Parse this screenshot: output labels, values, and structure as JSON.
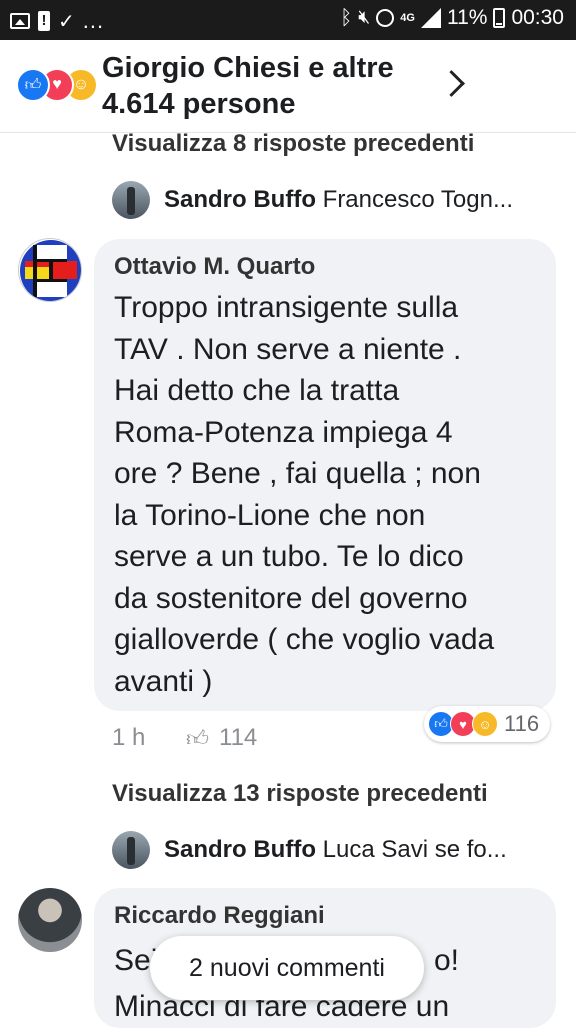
{
  "status_bar": {
    "network": "4G",
    "battery": "11%",
    "time": "00:30",
    "more": "..."
  },
  "header": {
    "title": "Giorgio Chiesi e altre 4.614 persone",
    "reactions": [
      "like",
      "love",
      "haha"
    ]
  },
  "thread1": {
    "view_previous": "Visualizza 8 risposte precedenti",
    "reply": {
      "name": "Sandro Buffo",
      "text": "Francesco Togn..."
    }
  },
  "comment1": {
    "name": "Ottavio M. Quarto",
    "text": "Troppo intransigente sulla\nTAV . Non serve a niente .\nHai detto che la tratta\nRoma-Potenza impiega 4\nore ? Bene , fai quella ; non\nla Torino-Lione che non\nserve a un tubo. Te lo dico\nda sostenitore del governo\ngialloverde ( che voglio vada\navanti )",
    "time": "1 h",
    "likes": "114",
    "reaction_count": "116"
  },
  "thread2": {
    "view_previous": "Visualizza 13 risposte precedenti",
    "reply": {
      "name": "Sandro Buffo",
      "text": "Luca Savi se fo..."
    }
  },
  "comment2": {
    "name": "Riccardo Reggiani",
    "text_visible": "Sei",
    "text_tail": "o!",
    "text_line2": "Minacci di fare cadere un"
  },
  "new_comments_pill": "2 nuovi commenti",
  "colors": {
    "like": "#1877f2",
    "love": "#f33e58",
    "haha": "#f7b928",
    "bubble": "#f0f2f5"
  }
}
